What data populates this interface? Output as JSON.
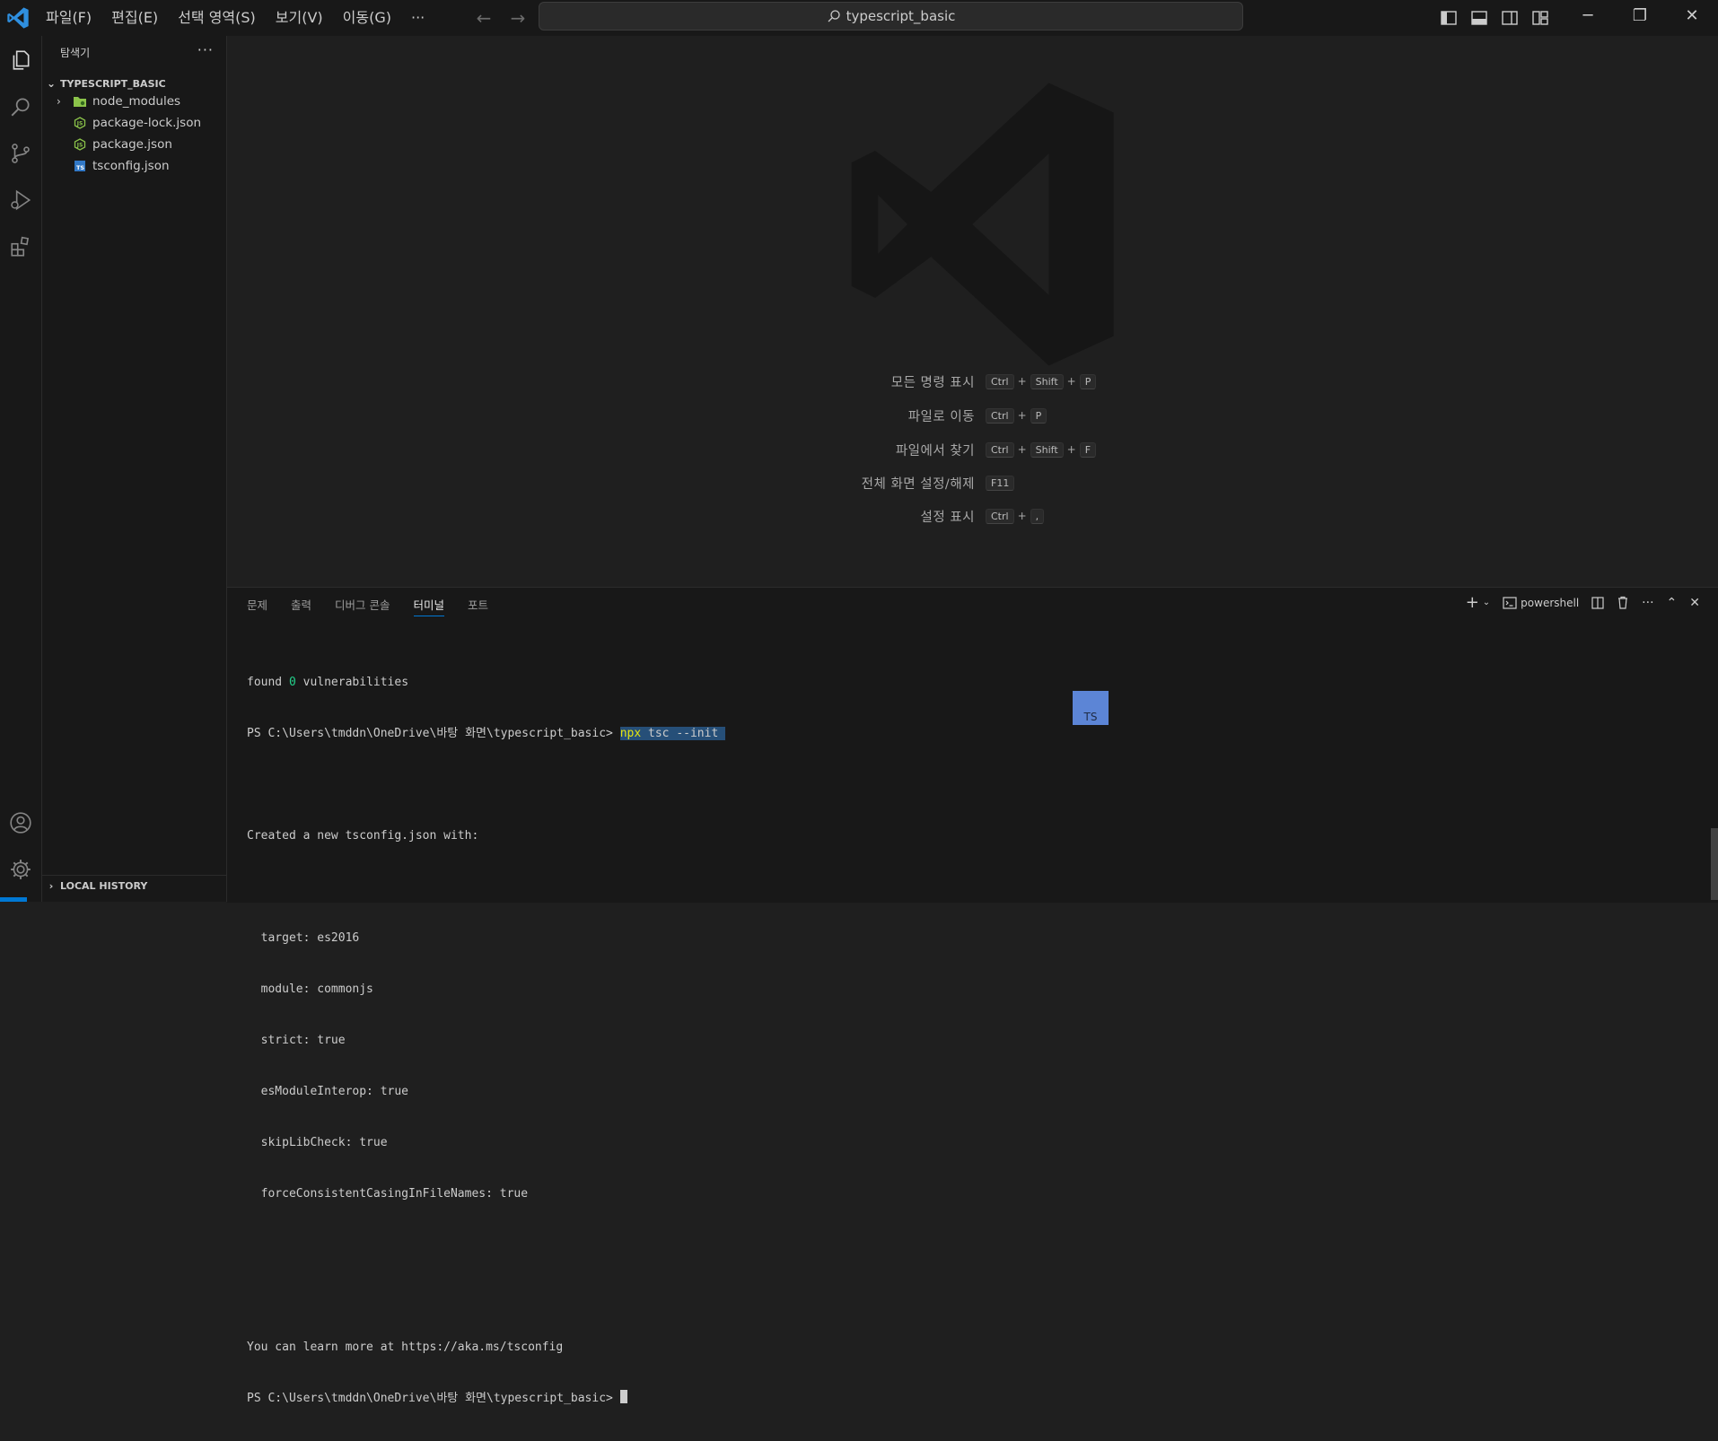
{
  "titlebar": {
    "menu": [
      "파일(F)",
      "편집(E)",
      "선택 영역(S)",
      "보기(V)",
      "이동(G)",
      "···"
    ],
    "search_text": "typescript_basic"
  },
  "sidebar": {
    "title": "탐색기",
    "more": "···",
    "folder": "TYPESCRIPT_BASIC",
    "items": [
      {
        "label": "node_modules",
        "icon": "folder-node-icon",
        "color": "#8bc34a"
      },
      {
        "label": "package-lock.json",
        "icon": "npm-json-icon",
        "color": "#8bc34a"
      },
      {
        "label": "package.json",
        "icon": "npm-json-icon",
        "color": "#8bc34a"
      },
      {
        "label": "tsconfig.json",
        "icon": "tsconfig-icon",
        "color": "#3178c6"
      }
    ],
    "local_history": "LOCAL HISTORY"
  },
  "editor": {
    "shortcuts": [
      {
        "label": "모든 명령 표시",
        "keys": [
          "Ctrl",
          "Shift",
          "P"
        ]
      },
      {
        "label": "파일로 이동",
        "keys": [
          "Ctrl",
          "P"
        ]
      },
      {
        "label": "파일에서 찾기",
        "keys": [
          "Ctrl",
          "Shift",
          "F"
        ]
      },
      {
        "label": "전체 화면 설정/해제",
        "keys": [
          "F11"
        ]
      },
      {
        "label": "설정 표시",
        "keys": [
          "Ctrl",
          ","
        ]
      }
    ]
  },
  "panel": {
    "tabs": [
      "문제",
      "출력",
      "디버그 콘솔",
      "터미널",
      "포트"
    ],
    "active_tab": "터미널",
    "shell": "powershell",
    "badge": "TS"
  },
  "terminal": {
    "l1_a": "found ",
    "l1_b": "0",
    "l1_c": " vulnerabilities",
    "prompt": "PS C:\\Users\\tmddn\\OneDrive\\바탕 화면\\typescript_basic> ",
    "cmd_a": "npx",
    "cmd_b": " tsc --init ",
    "created": "Created a new tsconfig.json with:",
    "options": [
      "  target: es2016",
      "  module: commonjs",
      "  strict: true",
      "  esModuleInterop: true",
      "  skipLibCheck: true",
      "  forceConsistentCasingInFileNames: true"
    ],
    "learn": "You can learn more at https://aka.ms/tsconfig"
  },
  "colors": {
    "accent": "#0078d4",
    "selection": "#264f78"
  }
}
